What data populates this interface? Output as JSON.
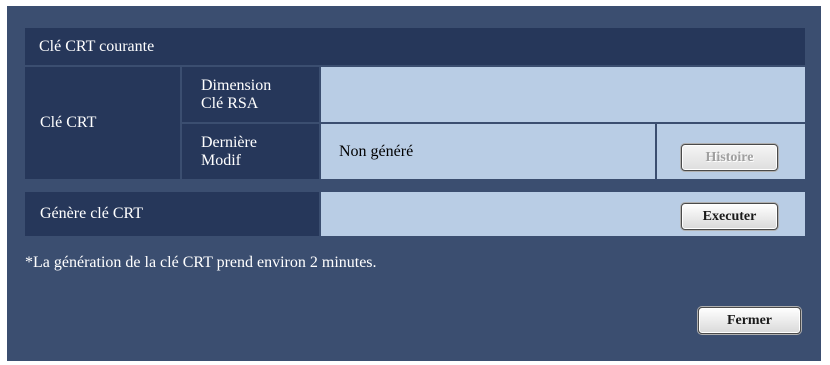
{
  "section_title": "Clé CRT courante",
  "crt_key": {
    "label": "Clé CRT",
    "rsa_size_label_line1": "Dimension",
    "rsa_size_label_line2": "Clé RSA",
    "rsa_size_value": "",
    "last_modified_label_line1": "Dernière",
    "last_modified_label_line2": "Modif",
    "last_modified_value": "Non généré",
    "history_button": "Histoire"
  },
  "generate": {
    "label": "Génère clé CRT",
    "execute_button": "Executer"
  },
  "note": "*La génération de la clé CRT prend environ 2 minutes.",
  "close_button": "Fermer"
}
